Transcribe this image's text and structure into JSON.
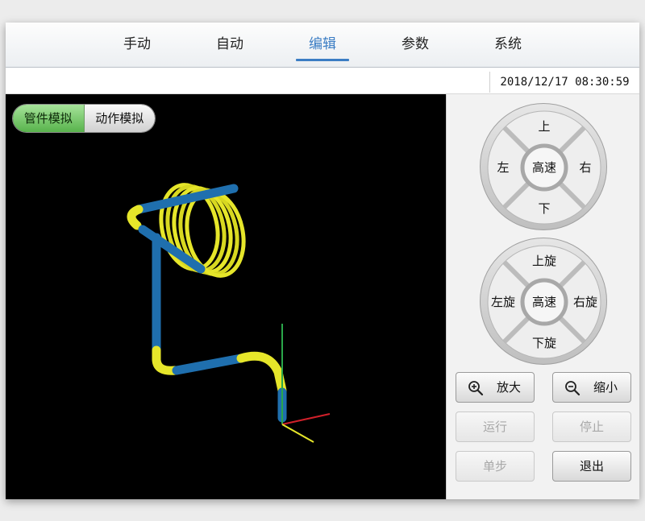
{
  "nav": {
    "tabs": [
      {
        "label": "手动",
        "active": false
      },
      {
        "label": "自动",
        "active": false
      },
      {
        "label": "编辑",
        "active": true
      },
      {
        "label": "参数",
        "active": false
      },
      {
        "label": "系统",
        "active": false
      }
    ]
  },
  "status": {
    "datetime": "2018/12/17 08:30:59"
  },
  "viewport": {
    "mode_tabs": [
      {
        "label": "管件模拟",
        "active": true
      },
      {
        "label": "动作模拟",
        "active": false
      }
    ],
    "colors": {
      "pipe_blue": "#1f6fae",
      "pipe_yellow": "#e6e62a",
      "axis_x": "#d0202a",
      "axis_y": "#2aa64a",
      "axis_z": "#e6e62a"
    }
  },
  "pan_pad": {
    "up": "上",
    "down": "下",
    "left": "左",
    "right": "右",
    "center": "高速"
  },
  "rotate_pad": {
    "up": "上旋",
    "down": "下旋",
    "left": "左旋",
    "right": "右旋",
    "center": "高速"
  },
  "buttons": {
    "zoom_in": "放大",
    "zoom_out": "缩小",
    "run": "运行",
    "stop": "停止",
    "step": "单步",
    "exit": "退出"
  }
}
